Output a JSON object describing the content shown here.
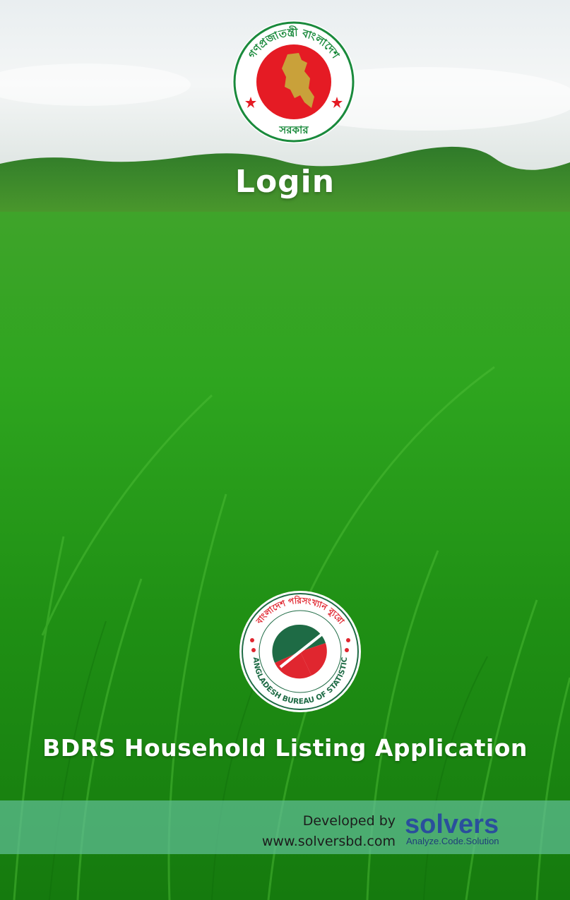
{
  "gov_seal": {
    "ring_text": "গণপ্রজাতন্ত্রী বাংলাদেশ",
    "bottom_text": "সরকার",
    "colors": {
      "ring": "#1a8a3c",
      "disc": "#e51b24",
      "map": "#c9a13a"
    }
  },
  "login": {
    "title": "Login"
  },
  "bbs_logo": {
    "ring_text_top": "বাংলাদেশ পরিসংখ্যান ব্যুরো",
    "ring_text_bottom": "BANGLADESH BUREAU OF STATISTICS",
    "colors": {
      "green": "#1e6b45",
      "red": "#e0262f"
    }
  },
  "app": {
    "title": "BDRS Household Listing Application"
  },
  "footer": {
    "developed_by": "Developed by",
    "website": "www.solversbd.com",
    "brand_name": "solvers",
    "brand_tagline": "Analyze.Code.Solution",
    "brand_color": "#2a4f9c"
  }
}
